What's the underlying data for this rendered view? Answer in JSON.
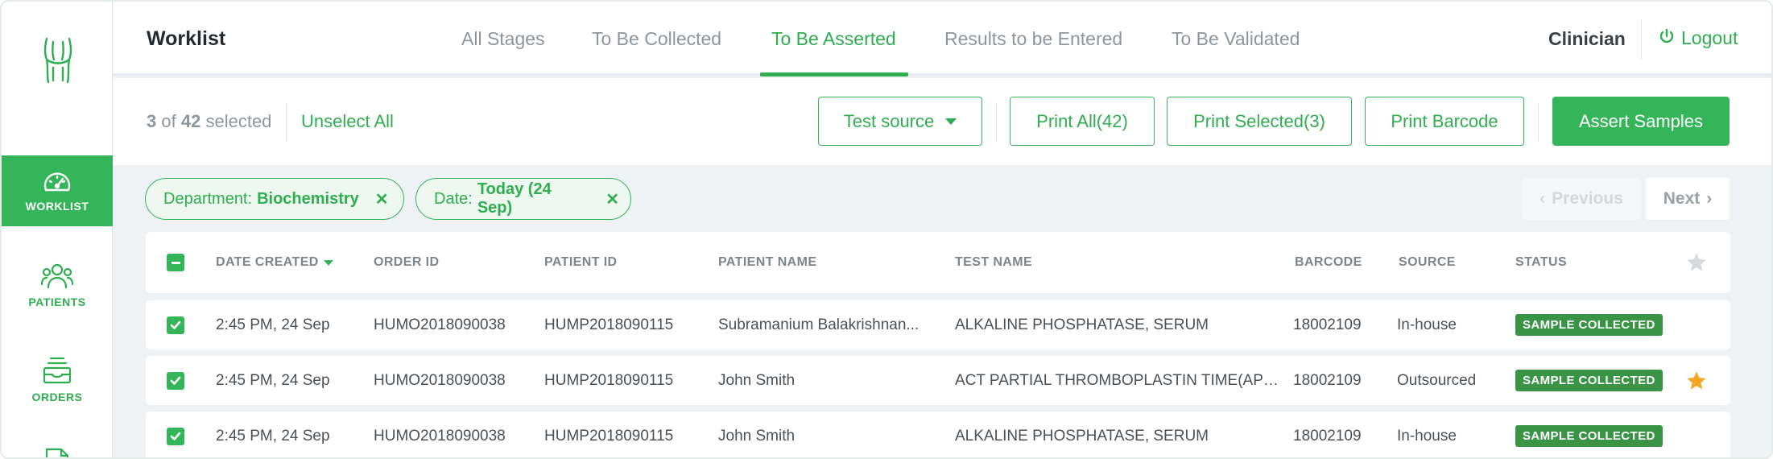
{
  "sidebar": {
    "items": [
      {
        "label": "WORKLIST",
        "icon": "dashboard-gauge-icon",
        "active": true
      },
      {
        "label": "PATIENTS",
        "icon": "patients-group-icon",
        "active": false
      },
      {
        "label": "ORDERS",
        "icon": "orders-tray-icon",
        "active": false
      }
    ]
  },
  "header": {
    "title": "Worklist",
    "tabs": [
      "All Stages",
      "To Be Collected",
      "To Be Asserted",
      "Results to be Entered",
      "To Be Validated"
    ],
    "active_tab": "To Be Asserted",
    "role": "Clinician",
    "logout_label": "Logout"
  },
  "toolbar": {
    "selected_count": "3",
    "of_label": "of",
    "total_count": "42",
    "selected_label": "selected",
    "unselect_all": "Unselect All",
    "test_source_label": "Test source",
    "print_all": "Print All(42)",
    "print_selected": "Print Selected(3)",
    "print_barcode": "Print Barcode",
    "assert_samples": "Assert Samples"
  },
  "filters": [
    {
      "key": "Department:",
      "value": "Biochemistry"
    },
    {
      "key": "Date:",
      "value": "Today (24 Sep)"
    }
  ],
  "pagination": {
    "previous": "Previous",
    "next": "Next"
  },
  "table": {
    "columns": [
      "DATE CREATED",
      "ORDER ID",
      "PATIENT ID",
      "PATIENT NAME",
      "TEST NAME",
      "BARCODE",
      "SOURCE",
      "STATUS"
    ],
    "rows": [
      {
        "date": "2:45 PM,  24 Sep",
        "order_id": "HUMO2018090038",
        "patient_id": "HUMP2018090115",
        "patient_name": "Subramanium Balakrishnan...",
        "test_name": "ALKALINE PHOSPHATASE, SERUM",
        "barcode": "18002109",
        "source": "In-house",
        "status": "SAMPLE COLLECTED",
        "starred": false
      },
      {
        "date": "2:45 PM,  24 Sep",
        "order_id": "HUMO2018090038",
        "patient_id": "HUMP2018090115",
        "patient_name": "John Smith",
        "test_name": "ACT PARTIAL THROMBOPLASTIN TIME(AP…",
        "barcode": "18002109",
        "source": "Outsourced",
        "status": "SAMPLE COLLECTED",
        "starred": true
      },
      {
        "date": "2:45 PM,  24 Sep",
        "order_id": "HUMO2018090038",
        "patient_id": "HUMP2018090115",
        "patient_name": "John Smith",
        "test_name": "ALKALINE PHOSPHATASE, SERUM",
        "barcode": "18002109",
        "source": "In-house",
        "status": "SAMPLE COLLECTED",
        "starred": false
      }
    ]
  },
  "colors": {
    "accent": "#34b55a",
    "badge": "#3a9446",
    "star": "#f5a623"
  }
}
